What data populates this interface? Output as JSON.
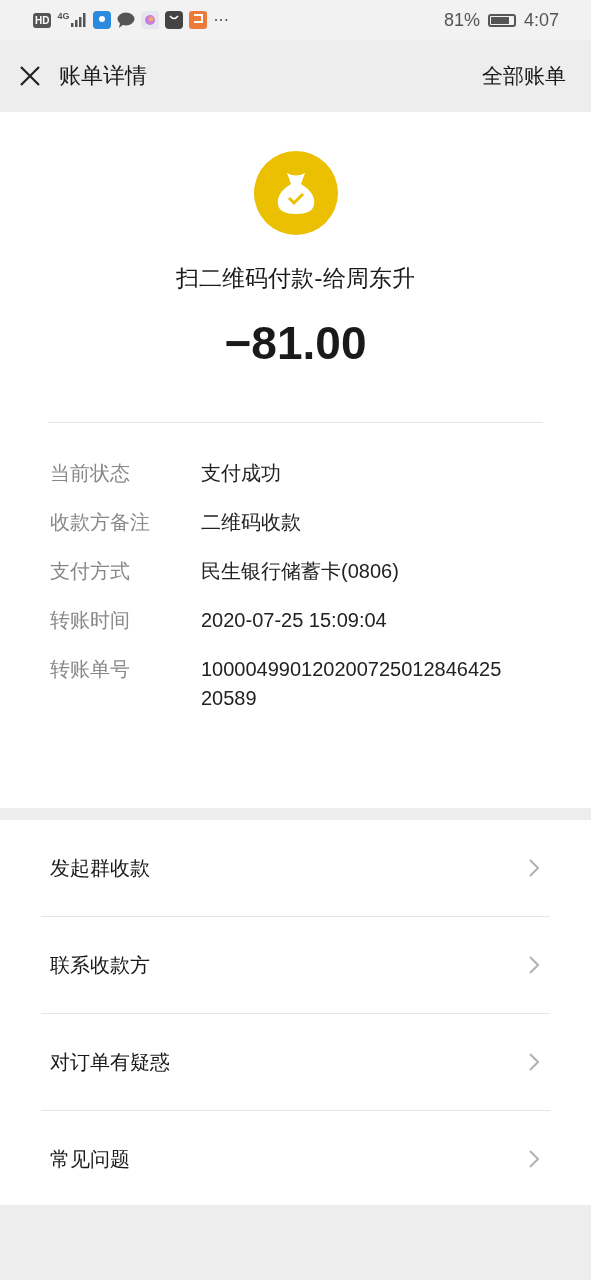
{
  "status_bar": {
    "badges": [
      "HD",
      "4G"
    ],
    "more": "···",
    "battery_text": "81%",
    "time": "4:07"
  },
  "header": {
    "title": "账单详情",
    "action": "全部账单"
  },
  "summary": {
    "title": "扫二维码付款-给周东升",
    "amount": "−81.00"
  },
  "details": [
    {
      "label": "当前状态",
      "value": "支付成功"
    },
    {
      "label": "收款方备注",
      "value": "二维码收款"
    },
    {
      "label": "支付方式",
      "value": "民生银行储蓄卡(0806)"
    },
    {
      "label": "转账时间",
      "value": "2020-07-25 15:09:04"
    },
    {
      "label": "转账单号",
      "value": "10000499012020072501284642520589"
    }
  ],
  "menu": [
    {
      "label": "发起群收款"
    },
    {
      "label": "联系收款方"
    },
    {
      "label": "对订单有疑惑"
    },
    {
      "label": "常见问题"
    }
  ]
}
